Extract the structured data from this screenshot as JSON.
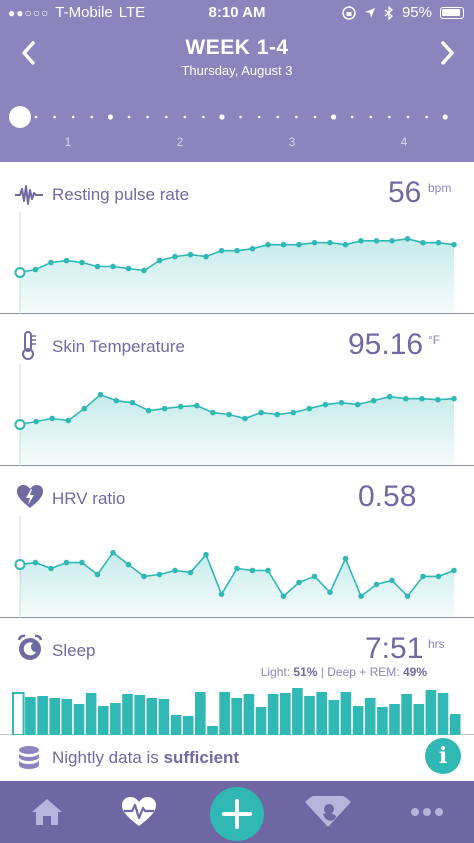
{
  "status_bar": {
    "carrier": "T-Mobile",
    "network": "LTE",
    "time": "8:10 AM",
    "battery": "95%"
  },
  "header": {
    "title": "WEEK 1-4",
    "subtitle": "Thursday, August 3",
    "week_ticks": [
      "1",
      "2",
      "3",
      "4"
    ]
  },
  "cards": {
    "pulse": {
      "title": "Resting pulse rate",
      "value": "56",
      "unit": "bpm",
      "series": [
        44,
        47,
        54,
        56,
        54,
        50,
        50,
        48,
        46,
        56,
        60,
        62,
        60,
        66,
        66,
        68,
        72,
        72,
        72,
        74,
        74,
        72,
        76,
        76,
        76,
        78,
        74,
        74,
        72
      ]
    },
    "skin": {
      "title": "Skin Temperature",
      "value": "95.16",
      "unit": "°F",
      "series": [
        44,
        47,
        50,
        48,
        60,
        74,
        68,
        66,
        58,
        60,
        62,
        63,
        56,
        54,
        50,
        56,
        54,
        56,
        60,
        64,
        66,
        64,
        68,
        72,
        70,
        70,
        69,
        70
      ]
    },
    "hrv": {
      "title": "HRV ratio",
      "value": "0.58",
      "unit": "",
      "series": [
        56,
        58,
        52,
        58,
        58,
        46,
        68,
        56,
        44,
        46,
        50,
        48,
        66,
        26,
        52,
        50,
        50,
        24,
        38,
        44,
        28,
        62,
        24,
        36,
        40,
        24,
        44,
        44,
        50
      ]
    },
    "sleep": {
      "title": "Sleep",
      "value": "7:51",
      "unit": "hrs",
      "light_label": "Light:",
      "light_value": "51%",
      "separator": "|",
      "deep_label": "Deep + REM:",
      "deep_value": "49%",
      "bars": [
        0.84,
        0.76,
        0.78,
        0.74,
        0.72,
        0.62,
        0.84,
        0.58,
        0.64,
        0.82,
        0.8,
        0.74,
        0.72,
        0.4,
        0.38,
        0.86,
        0.18,
        0.86,
        0.74,
        0.82,
        0.56,
        0.82,
        0.84,
        0.94,
        0.78,
        0.86,
        0.7,
        0.86,
        0.58,
        0.74,
        0.56,
        0.62,
        0.82,
        0.62,
        0.9,
        0.84,
        0.42
      ]
    }
  },
  "info": {
    "prefix": "Nightly data is",
    "emphasis": "sufficient",
    "button_label": "i"
  },
  "colors": {
    "header": "#8b84bd",
    "accent": "#2fb8b4",
    "text": "#6f6aa2",
    "tabbar": "#6e67a3"
  },
  "icons": {
    "pulse": "waveform-icon",
    "skin": "thermometer-icon",
    "hrv": "heart-bolt-icon",
    "sleep": "alarm-clock-icon",
    "info": "database-icon",
    "tabs": [
      "home-icon",
      "heart-pulse-icon",
      "plus-icon",
      "ultrasound-icon",
      "more-icon"
    ]
  }
}
